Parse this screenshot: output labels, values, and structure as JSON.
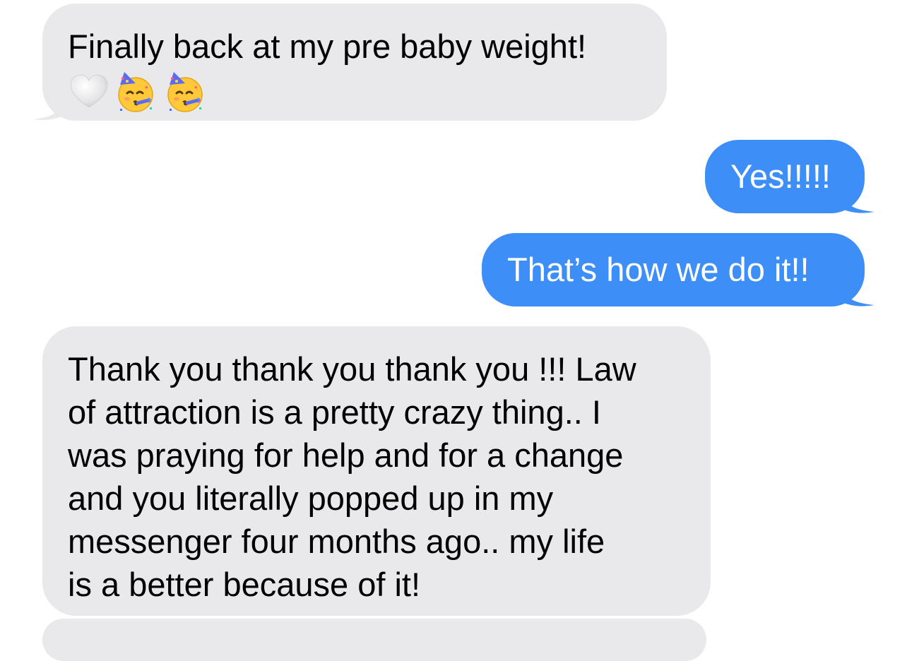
{
  "conversation": {
    "messages": [
      {
        "direction": "received",
        "text": "Finally back at my pre baby weight!",
        "emojis": [
          "white-heart-icon",
          "partying-face-icon",
          "partying-face-icon"
        ]
      },
      {
        "direction": "sent",
        "text": "Yes!!!!!"
      },
      {
        "direction": "sent",
        "text": "That’s how we do it!!"
      },
      {
        "direction": "received",
        "lines": [
          "Thank you thank you thank you !!! Law",
          "of attraction is a pretty crazy thing.. I",
          "was praying for help and for a change",
          "and you literally popped up in my",
          "messenger four months ago.. my life",
          "is a better because of it!"
        ]
      }
    ]
  },
  "colors": {
    "received_bubble": "#e9e9eb",
    "sent_bubble": "#3d8ef6",
    "received_text": "#000000",
    "sent_text": "#ffffff",
    "background": "#ffffff"
  }
}
